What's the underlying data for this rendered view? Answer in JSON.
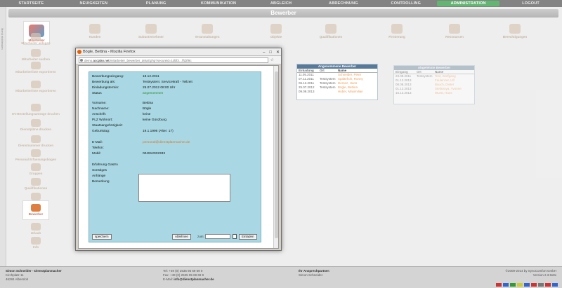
{
  "topnav": [
    "STARTSEITE",
    "NEUIGKEITEN",
    "PLANUNG",
    "KOMMUNIKATION",
    "ABGLEICH",
    "ABRECHNUNG",
    "CONTROLLING",
    "ADMINISTRATION",
    "LOGOUT"
  ],
  "page_title": "Bewerber",
  "left_strip": "Menü einblenden",
  "sidebar": {
    "mitarbeiter": "Mitarbeiter",
    "items": [
      "Mitarbeiter anlegen",
      "Mitarbeiter suchen",
      "Mitarbeiterliste exportieren",
      "Mitarbeiterliste exportieren",
      "EV-Bestellungsanträge drucken",
      "Dienstpläne drucken",
      "Dienstnummer drucken",
      "Personal Erfassungsbogen",
      "Gruppen",
      "Qualifikationen",
      "Verträge",
      "Bewerber",
      "Urlaub",
      "Info"
    ]
  },
  "iconrow": [
    "Kunden",
    "Subunternehmer",
    "Veranstaltungen",
    "Objekte",
    "Qualifikationen",
    "Firmierung",
    "Ressourcen",
    "Berechtigungen"
  ],
  "dialog": {
    "title": "Bögle, Bettina - Mozilla Firefox",
    "url_prefix": "demo.",
    "url_domain": "accplan.net",
    "url_rest": "/mitarbeiter_bewerber_detail.php?secureid=1dbf3…ffd2f9c",
    "fields": [
      {
        "label": "Bewerbungseingang:",
        "value": "18.12.2011",
        "style": ""
      },
      {
        "label": "Bewerbung als:",
        "value": "Testsystem: Servicekraft - Teilzeit",
        "style": ""
      },
      {
        "label": "Einladungstermin:",
        "value": "25.07.2012 08:00 Uhr",
        "style": ""
      },
      {
        "label": "Status",
        "value": "angenommen",
        "style": "green"
      },
      {
        "label": "Vorname:",
        "value": "Bettina",
        "style": ""
      },
      {
        "label": "Nachname:",
        "value": "Bögle",
        "style": ""
      },
      {
        "label": "Anschrift:",
        "value": "keine",
        "style": ""
      },
      {
        "label": "PLZ Wohnort:",
        "value": "keine Günzburg",
        "style": ""
      },
      {
        "label": "Staatsangehörigkeit:",
        "value": "",
        "style": ""
      },
      {
        "label": "Geburtstag:",
        "value": "19.1.1996 (Alter: 17)",
        "style": ""
      },
      {
        "label": "E-Mail:",
        "value": "personal@dienstplanmacher.de",
        "style": "orange"
      },
      {
        "label": "Telefon:",
        "value": "",
        "style": ""
      },
      {
        "label": "Mobil:",
        "value": "004912032333",
        "style": ""
      },
      {
        "label": "Erfahrung Gastro",
        "value": "",
        "style": ""
      },
      {
        "label": "Sonstiges",
        "value": "",
        "style": ""
      },
      {
        "label": "Anhänge",
        "value": "",
        "style": ""
      },
      {
        "label": "Bemerkung",
        "value": "",
        "style": ""
      }
    ],
    "btn_save": "speichern",
    "btn_reject": "Ablehnen",
    "zum": "zum:",
    "btn_invite": "Einladen"
  },
  "accepted": {
    "title": "Angenommene Bewerber",
    "headers": [
      "Einladung",
      "Ort",
      "Name"
    ],
    "rows": [
      [
        "11.05.2011",
        "",
        "Schneider, Peter"
      ],
      [
        "07.11.2011",
        "Testsystem",
        "Spaltehoh, Ronny"
      ],
      [
        "06.12.2011",
        "Testsystem",
        "Demez, Hans"
      ],
      [
        "25.07.2012",
        "Testsystem",
        "Bögle, Bettina"
      ],
      [
        "09.09.2013",
        "",
        "Huber, Maximilian"
      ]
    ]
  },
  "rejected": {
    "title": "Abgelehnte Bewerber",
    "headers": [
      "Eingang",
      "Ort",
      "Name"
    ],
    "rows": [
      [
        "23.08.2011",
        "Testsystem",
        "Test, Wolfgang"
      ],
      [
        "01.12.2013",
        "",
        "Faulenzer, Ulf"
      ],
      [
        "08.08.2013",
        "",
        "Bauch, Dieter"
      ],
      [
        "01.12.2013",
        "",
        "Stefanoya, Yvonne"
      ],
      [
        "15.12.2013",
        "",
        "Wurst, Hans"
      ]
    ]
  },
  "footer": {
    "company": "Simon Schneider - Dienstplanmacher",
    "street": "Kirchplatz 11",
    "city": "46284 Albersloh",
    "tel": "Tel: +49 (0) 2535 95 69 69 0",
    "fax": "Fax: +49 (0) 2535 95 69 69 9",
    "email_label": "E-Mail:",
    "email": "info@dienstplanmacher.de",
    "contact_title": "Ihr Ansprechpartner:",
    "contact_name": "Simon Schneider",
    "copyright": "©2009-2014 by SyncComfort GmbH",
    "version": "Version 2.3.9x8x"
  }
}
